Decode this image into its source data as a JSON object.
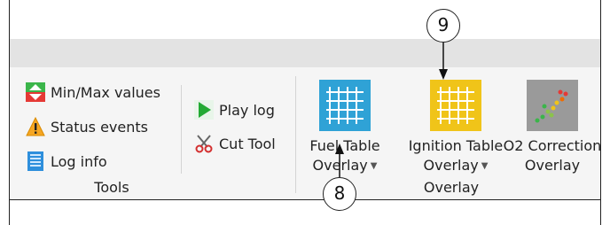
{
  "tools": {
    "min_max_label": "Min/Max values",
    "status_events_label": "Status events",
    "log_info_label": "Log info",
    "play_log_label": "Play log",
    "cut_tool_label": "Cut Tool",
    "group_label": "Tools"
  },
  "overlay": {
    "fuel_table": {
      "line1": "Fuel Table",
      "line2": "Overlay"
    },
    "ignition_table": {
      "line1": "Ignition Table",
      "line2": "Overlay"
    },
    "o2_correction": {
      "line1": "O2 Correction",
      "line2": "Overlay"
    },
    "group_label": "Overlay"
  },
  "callouts": {
    "top": "9",
    "bottom": "8"
  },
  "colors": {
    "fuel_icon_bg": "#2fa2d6",
    "ignition_icon_bg": "#f0c419",
    "o2_icon_bg": "#9a9a9a",
    "play_green": "#22aa33",
    "ribbon_bg": "#f5f5f5",
    "tabstrip_bg": "#e3e3e3"
  }
}
